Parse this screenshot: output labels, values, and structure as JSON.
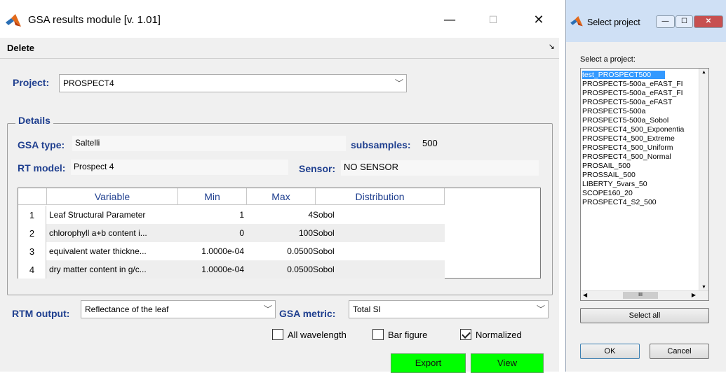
{
  "main_window": {
    "title": "GSA results module [v. 1.01]",
    "controls": {
      "minimize": "—",
      "maximize": "☐",
      "close": "✕"
    },
    "menu": {
      "delete": "Delete",
      "dock_arrow": "↘"
    },
    "project": {
      "label": "Project:",
      "value": "PROSPECT4"
    },
    "details": {
      "title": "Details",
      "gsa_type_label": "GSA type:",
      "gsa_type_value": "Saltelli",
      "subsamples_label": "subsamples:",
      "subsamples_value": "500",
      "rt_model_label": "RT model:",
      "rt_model_value": "Prospect 4",
      "sensor_label": "Sensor:",
      "sensor_value": "NO SENSOR"
    },
    "table": {
      "headers": [
        "Variable",
        "Min",
        "Max",
        "Distribution"
      ],
      "rows": [
        {
          "n": "1",
          "variable": "Leaf Structural Parameter",
          "min": "1",
          "max": "4",
          "dist": "Sobol"
        },
        {
          "n": "2",
          "variable": "chlorophyll a+b content i...",
          "min": "0",
          "max": "100",
          "dist": "Sobol"
        },
        {
          "n": "3",
          "variable": "equivalent water thickne...",
          "min": "1.0000e-04",
          "max": "0.0500",
          "dist": "Sobol"
        },
        {
          "n": "4",
          "variable": "dry matter content in g/c...",
          "min": "1.0000e-04",
          "max": "0.0500",
          "dist": "Sobol"
        }
      ]
    },
    "rtm_output": {
      "label": "RTM output:",
      "value": "Reflectance of the leaf"
    },
    "gsa_metric": {
      "label": "GSA metric:",
      "value": "Total SI"
    },
    "checkboxes": [
      {
        "label": "All wavelength",
        "checked": false
      },
      {
        "label": "Bar figure",
        "checked": false
      },
      {
        "label": "Normalized",
        "checked": true
      }
    ],
    "buttons": {
      "export": "Export",
      "view": "View"
    }
  },
  "select_window": {
    "title": "Select project",
    "prompt": "Select a project:",
    "items": [
      "test_PROSPECT500",
      "PROSPECT5-500a_eFAST_FI",
      "PROSPECT5-500a_eFAST_FI",
      "PROSPECT5-500a_eFAST",
      "PROSPECT5-500a",
      "PROSPECT5-500a_Sobol",
      "PROSPECT4_500_Exponentia",
      "PROSPECT4_500_Extreme",
      "PROSPECT4_500_Uniform",
      "PROSPECT4_500_Normal",
      "PROSAIL_500",
      "PROSSAIL_500",
      "LIBERTY_5vars_50",
      "SCOPE160_20",
      "PROSPECT4_S2_500"
    ],
    "scroll_thumb": "III",
    "select_all": "Select all",
    "ok": "OK",
    "cancel": "Cancel"
  },
  "colors": {
    "label_blue": "#1f3f8f",
    "button_green": "#00ff00",
    "selection": "#3399ff"
  }
}
